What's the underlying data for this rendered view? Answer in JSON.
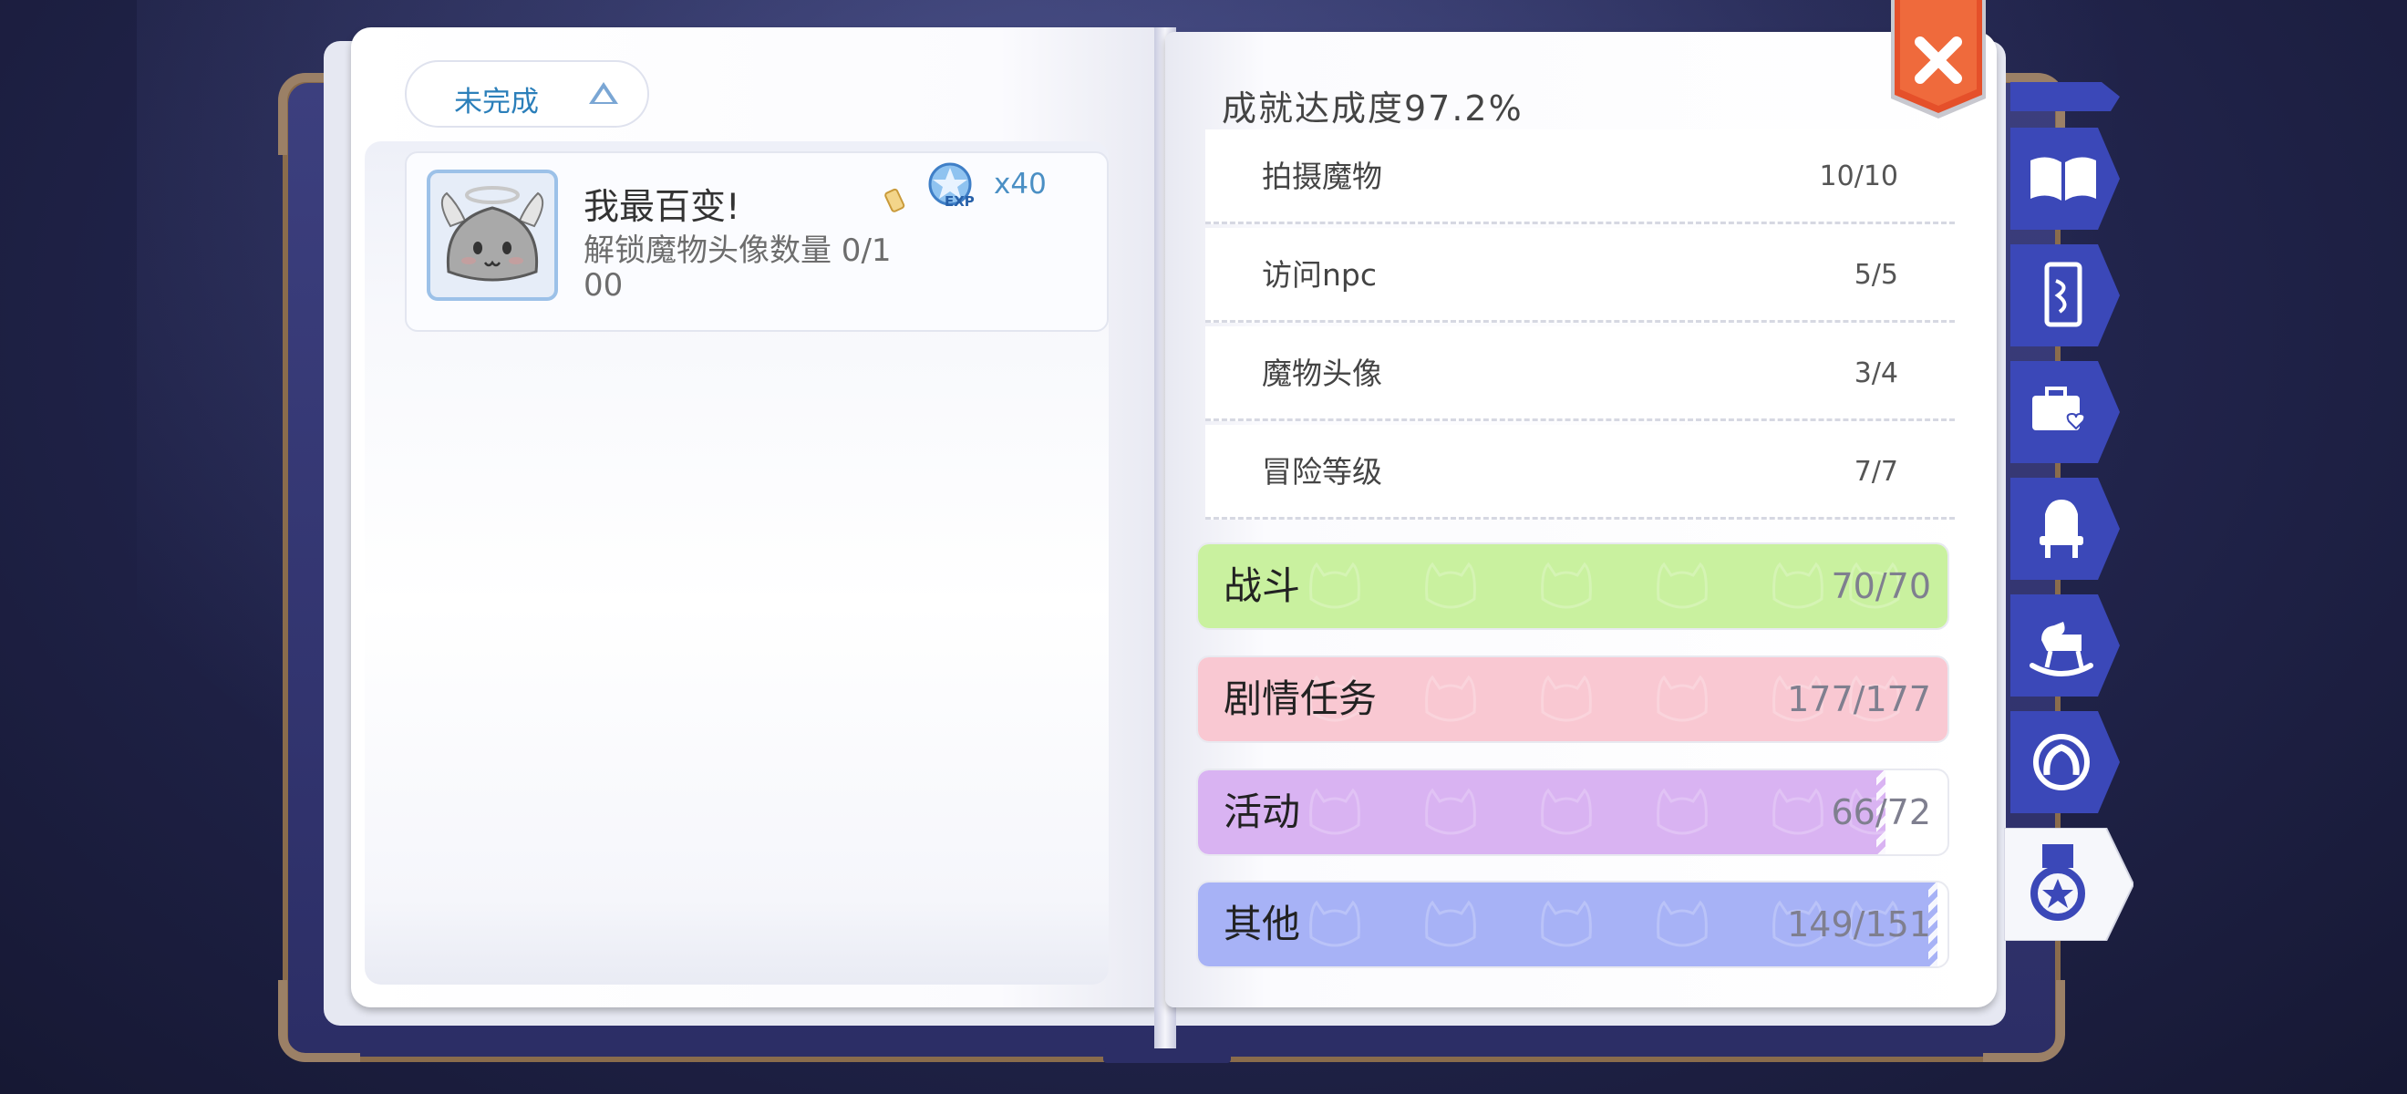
{
  "filter": {
    "label": "未完成"
  },
  "achievement": {
    "title": "我最百变!",
    "description": "解锁魔物头像数量 0/100",
    "description_line1": "解锁魔物头像数量 0/1",
    "description_line2": "00",
    "reward_icon": "exp-icon",
    "reward_qty": "x40"
  },
  "progress": {
    "title": "成就达成度97.2%",
    "sub_items": [
      {
        "label": "拍摄魔物",
        "value": "10/10"
      },
      {
        "label": "访问npc",
        "value": "5/5"
      },
      {
        "label": "魔物头像",
        "value": "3/4"
      },
      {
        "label": "冒险等级",
        "value": "7/7"
      }
    ],
    "categories": [
      {
        "label": "战斗",
        "value": "70/70",
        "done": 70,
        "total": 70,
        "color": "#c9f19f"
      },
      {
        "label": "剧情任务",
        "value": "177/177",
        "done": 177,
        "total": 177,
        "color": "#f9c8d2"
      },
      {
        "label": "活动",
        "value": "66/72",
        "done": 66,
        "total": 72,
        "color": "#d9b3f2"
      },
      {
        "label": "其他",
        "value": "149/151",
        "done": 149,
        "total": 151,
        "color": "#a7b2f6"
      }
    ]
  },
  "side_tabs": [
    {
      "icon": "book-icon"
    },
    {
      "icon": "card-icon"
    },
    {
      "icon": "briefcase-heart-icon"
    },
    {
      "icon": "chair-icon"
    },
    {
      "icon": "rocking-horse-icon"
    },
    {
      "icon": "horseshoe-icon"
    },
    {
      "icon": "medal-icon",
      "active": true
    }
  ],
  "colors": {
    "tab_blue": "#3b48b8",
    "close_red": "#e5502a",
    "accent_blue": "#2b7fba"
  }
}
